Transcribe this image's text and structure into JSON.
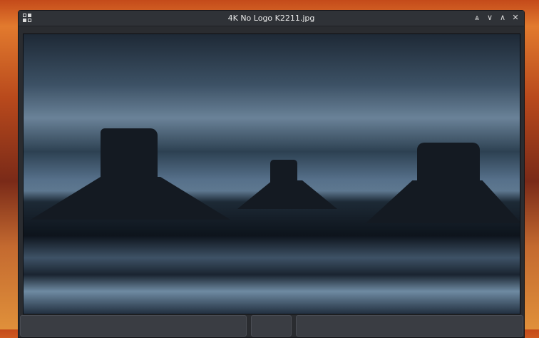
{
  "window": {
    "title": "4K No Logo K2211.jpg"
  },
  "controls": {
    "keep_above": "⩓",
    "minimize": "∨",
    "maximize": "∧",
    "close": "✕"
  },
  "image": {
    "description_icon": "image-view"
  }
}
